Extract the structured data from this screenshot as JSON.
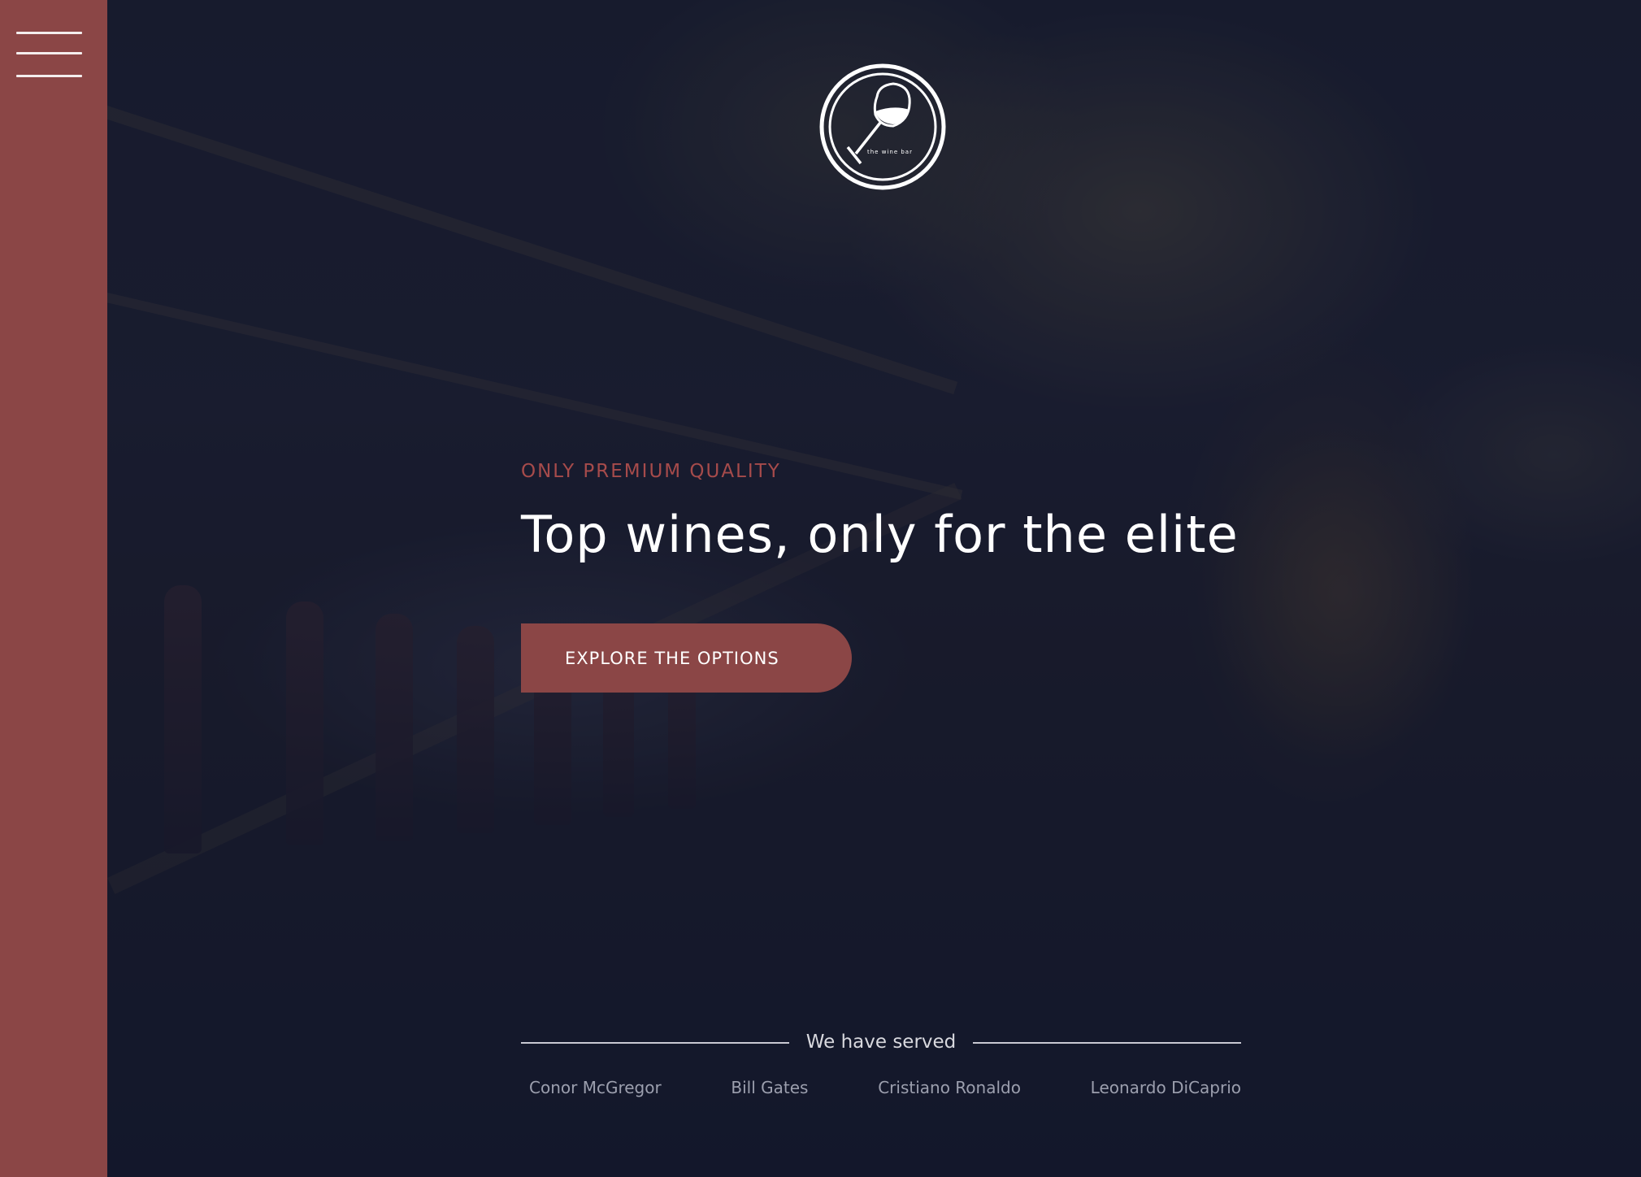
{
  "sidebar": {
    "menu_icon": "hamburger-menu-icon",
    "color": "#8b4646"
  },
  "logo": {
    "icon": "wine-glass-icon",
    "text": "the wine bar"
  },
  "hero": {
    "eyebrow": "ONLY PREMIUM QUALITY",
    "headline": "Top wines, only for the elite",
    "cta_label": "EXPLORE THE OPTIONS",
    "accent_color": "#a64b4b"
  },
  "served": {
    "label": "We have served",
    "names": [
      "Conor McGregor",
      "Bill Gates",
      "Cristiano Ronaldo",
      "Leonardo DiCaprio"
    ]
  }
}
